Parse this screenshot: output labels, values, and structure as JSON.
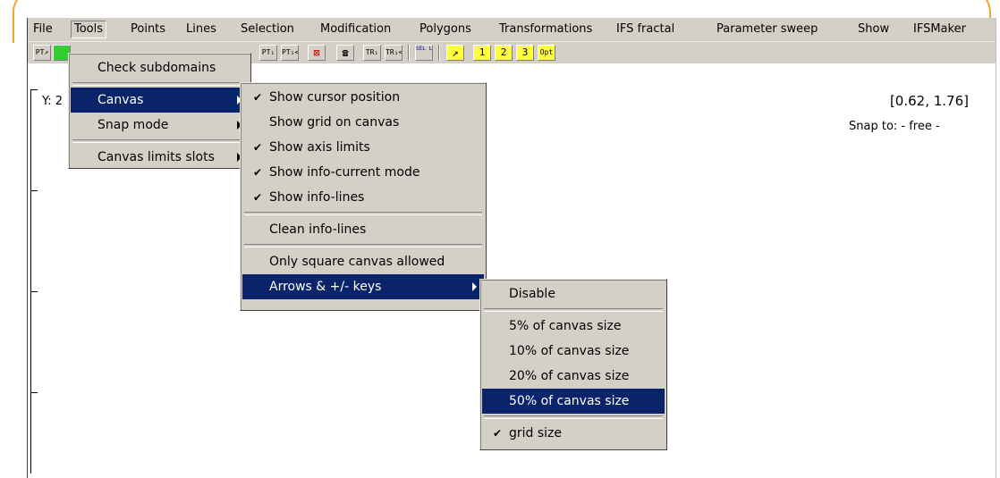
{
  "menubar": {
    "items": [
      "File",
      "Tools",
      "Points",
      "Lines",
      "Selection",
      "Modification",
      "Polygons",
      "Transformations",
      "IFS fractal",
      "Parameter sweep",
      "Show",
      "IFSMaker"
    ]
  },
  "toolbar": {
    "buttons": [
      "PT↗",
      "PT₁",
      "PT₁<",
      "⊠",
      "☎",
      "TR₁",
      "TR₁<",
      "SEL LIST",
      "↗",
      "1",
      "2",
      "3",
      "Opt"
    ]
  },
  "canvas": {
    "y_label": "Y: 2",
    "coords": "[0.62, 1.76]",
    "snap": "Snap to: - free -"
  },
  "tools_menu": {
    "items": [
      {
        "label": "Check subdomains",
        "submenu": false
      },
      {
        "label": "Canvas",
        "submenu": true,
        "highlight": true
      },
      {
        "label": "Snap mode",
        "submenu": true
      },
      {
        "label": "Canvas limits slots",
        "submenu": true
      }
    ]
  },
  "canvas_menu": {
    "items": [
      {
        "label": "Show cursor position",
        "checked": true
      },
      {
        "label": "Show grid on canvas",
        "checked": false
      },
      {
        "label": "Show axis limits",
        "checked": true
      },
      {
        "label": "Show info-current mode",
        "checked": true
      },
      {
        "label": "Show info-lines",
        "checked": true
      },
      {
        "label": "Clean info-lines",
        "checked": false
      },
      {
        "label": "Only square canvas allowed",
        "checked": false
      },
      {
        "label": "Arrows & +/- keys",
        "checked": false,
        "submenu": true,
        "highlight": true
      }
    ]
  },
  "arrows_menu": {
    "items": [
      {
        "label": "Disable",
        "checked": false
      },
      {
        "label": "5% of canvas size",
        "checked": false
      },
      {
        "label": "10% of canvas size",
        "checked": false
      },
      {
        "label": "20% of canvas size",
        "checked": false
      },
      {
        "label": "50% of canvas size",
        "checked": false,
        "highlight": true
      },
      {
        "label": "grid size",
        "checked": true
      }
    ]
  },
  "check_glyph": "✔"
}
